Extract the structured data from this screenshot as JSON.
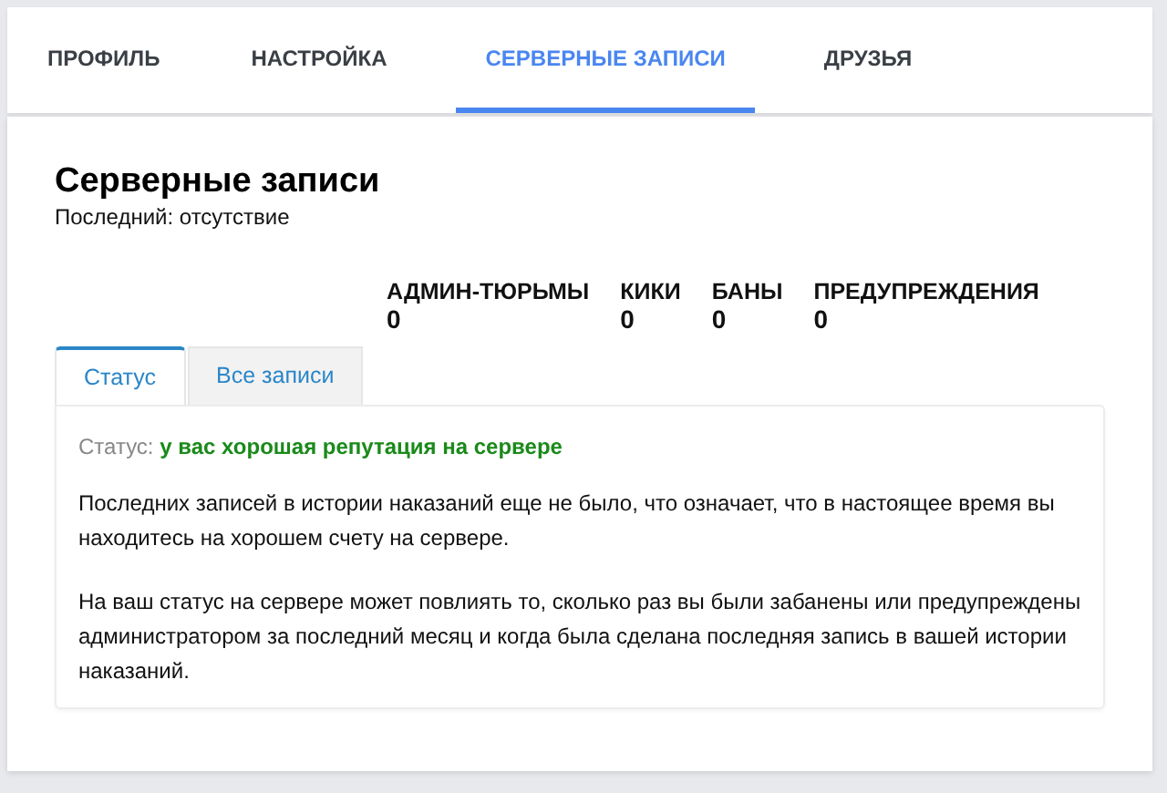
{
  "nav_tabs": [
    {
      "label": "ПРОФИЛЬ",
      "selected": false
    },
    {
      "label": "НАСТРОЙКА",
      "selected": false
    },
    {
      "label": "СЕРВЕРНЫЕ ЗАПИСИ",
      "selected": true
    },
    {
      "label": "ДРУЗЬЯ",
      "selected": false
    }
  ],
  "title": "Серверные записи",
  "subtitle": "Последний: отсутствие",
  "stats": [
    {
      "label": "АДМИН-ТЮРЬМЫ",
      "value": "0"
    },
    {
      "label": "КИКИ",
      "value": "0"
    },
    {
      "label": "БАНЫ",
      "value": "0"
    },
    {
      "label": "ПРЕДУПРЕЖДЕНИЯ",
      "value": "0"
    }
  ],
  "sub_tabs": [
    {
      "label": "Статус",
      "selected": true
    },
    {
      "label": "Все записи",
      "selected": false
    }
  ],
  "status": {
    "label": "Статус:",
    "value": "у вас хорошая репутация на сервере"
  },
  "paragraphs": [
    "Последних записей в истории наказаний еще не было, что означает, что в настоящее время вы находитесь на хорошем счету на сервере.",
    "На ваш статус на сервере может повлиять то, сколько раз вы были забанены или предупреждены администратором за последний месяц и когда была сделана последняя запись в вашей истории наказаний."
  ]
}
